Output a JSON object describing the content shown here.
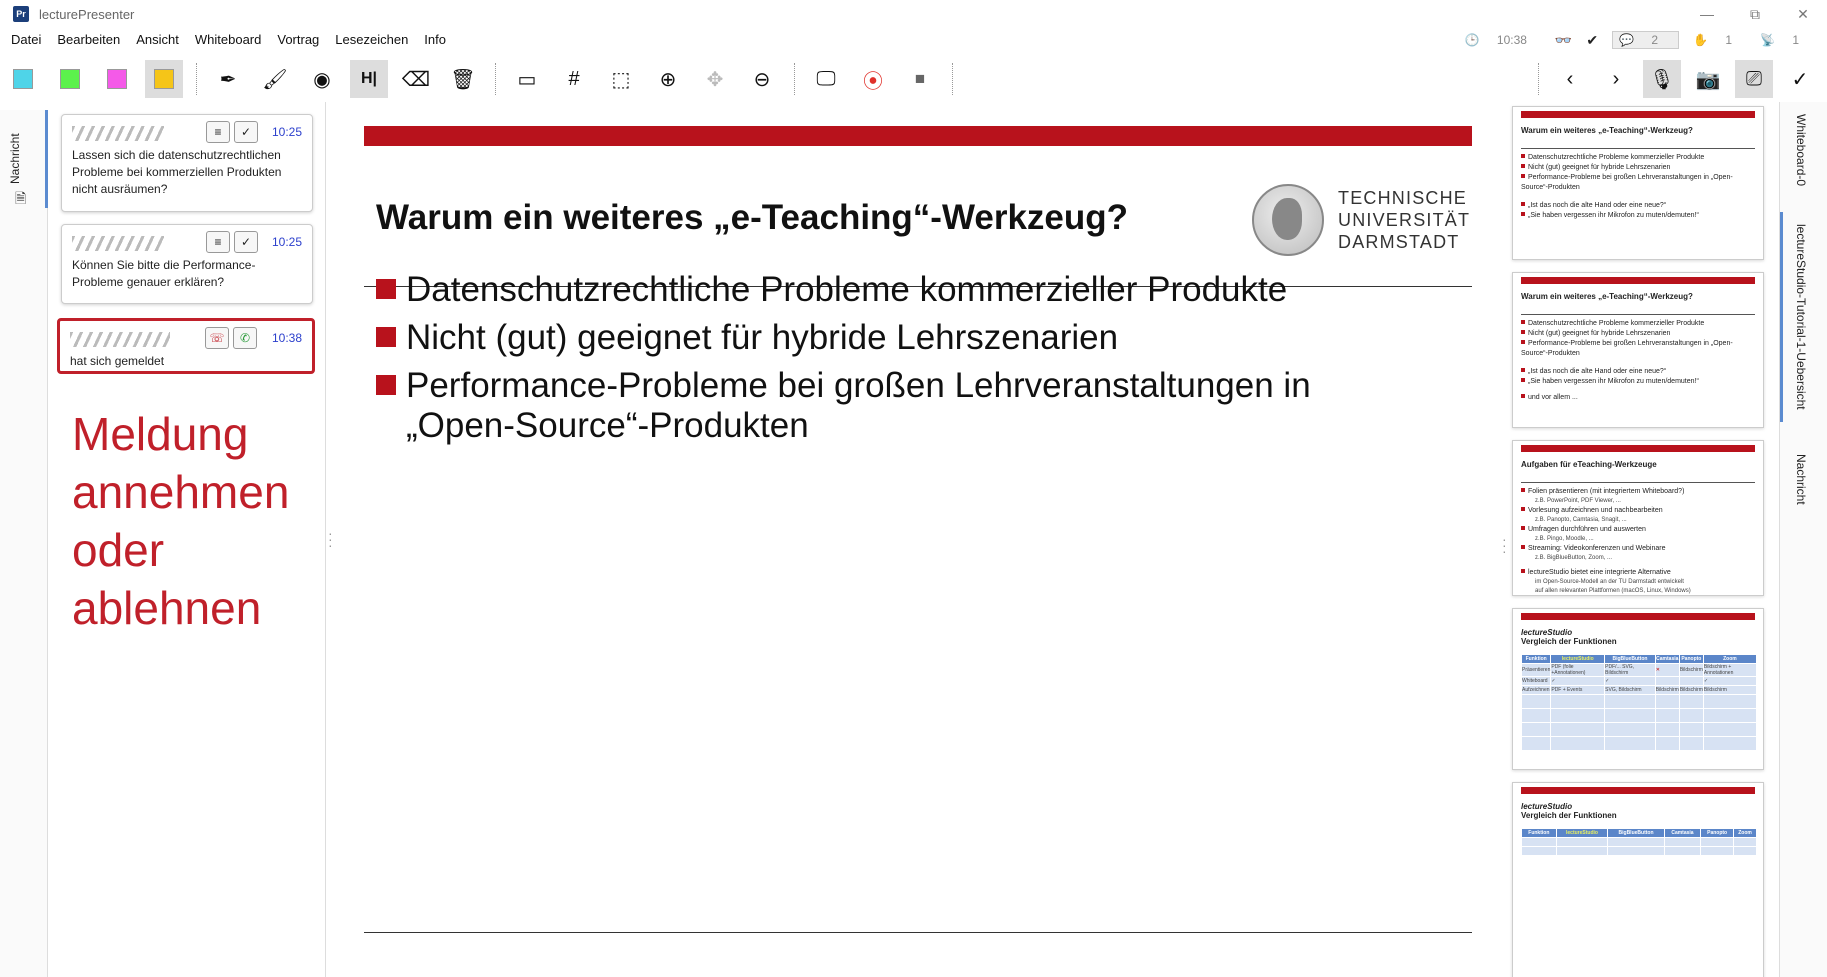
{
  "titlebar": {
    "app_icon": "Pr",
    "title": "lecturePresenter",
    "minimize": "—",
    "maximize": "⧉",
    "close": "✕"
  },
  "menu": [
    "Datei",
    "Bearbeiten",
    "Ansicht",
    "Whiteboard",
    "Vortrag",
    "Lesezeichen",
    "Info"
  ],
  "status": {
    "time": "10:38",
    "hands_count": "2",
    "speech_count": "1",
    "stream_count": "1",
    "hand_value": "1"
  },
  "toolbar": {
    "colors": [
      "#4fd4e8",
      "#5cf24c",
      "#f45ae8",
      "#f5c518"
    ],
    "tools": [
      "pen-icon",
      "highlighter-icon",
      "pointer-icon",
      "text-icon",
      "eraser-icon",
      "trash-icon",
      "grid-image-icon",
      "grid-icon",
      "select-icon",
      "zoom-in-icon",
      "pan-icon",
      "zoom-out-icon",
      "screen-icon",
      "record-icon",
      "stop-icon"
    ],
    "right": [
      "prev-icon",
      "next-icon",
      "microphone-icon",
      "camera-icon",
      "cast-icon",
      "check-icon"
    ]
  },
  "left_tab": "Nachricht",
  "messages": [
    {
      "time": "10:25",
      "text": "Lassen sich die datenschutzrechtlichen Probleme bei kommerziellen Produkten nicht ausräumen?"
    },
    {
      "time": "10:25",
      "text": "Können Sie bitte die Performance-Probleme genauer erklären?"
    },
    {
      "time": "10:38",
      "text": "hat sich gemeldet"
    }
  ],
  "annotation": [
    "Meldung",
    "annehmen",
    "oder",
    "ablehnen"
  ],
  "slide": {
    "title": "Warum ein weiteres „e-Teaching“-Werkzeug?",
    "logo": [
      "TECHNISCHE",
      "UNIVERSITÄT",
      "DARMSTADT"
    ],
    "bullets": [
      "Datenschutzrechtliche Probleme kommerzieller Produkte",
      "Nicht (gut) geeignet für hybride Lehrszenarien",
      "Performance-Probleme bei großen Lehrveranstaltungen in",
      "„Open-Source“-Produkten"
    ]
  },
  "thumbs": [
    {
      "title": "Warum ein weiteres „e-Teaching“-Werkzeug?",
      "lines": [
        "Datenschutzrechtliche Probleme kommerzieller Produkte",
        "Nicht (gut) geeignet für hybride Lehrszenarien",
        "Performance-Probleme bei großen Lehrveranstaltungen in „Open-Source“-Produkten",
        "„Ist das noch die alte Hand oder eine neue?“",
        "„Sie haben vergessen ihr Mikrofon zu muten/demuten!“"
      ]
    },
    {
      "title": "Warum ein weiteres „e-Teaching“-Werkzeug?",
      "lines": [
        "Datenschutzrechtliche Probleme kommerzieller Produkte",
        "Nicht (gut) geeignet für hybride Lehrszenarien",
        "Performance-Probleme bei großen Lehrveranstaltungen in „Open-Source“-Produkten",
        "„Ist das noch die alte Hand oder eine neue?“",
        "„Sie haben vergessen ihr Mikrofon zu muten/demuten!“",
        "und vor allem ..."
      ]
    },
    {
      "title": "Aufgaben für eTeaching-Werkzeuge",
      "items": [
        {
          "b": "Folien präsentieren (mit integriertem Whiteboard?)",
          "s": "z.B. PowerPoint, PDF Viewer, ..."
        },
        {
          "b": "Vorlesung aufzeichnen und nachbearbeiten",
          "s": "z.B. Panopto, Camtasia, Snagit, ..."
        },
        {
          "b": "Umfragen durchführen und auswerten",
          "s": "z.B. Pingo, Moodle, ..."
        },
        {
          "b": "Streaming: Videokonferenzen und Webinare",
          "s": "z.B. BigBlueButton, Zoom, ..."
        },
        {
          "b": "lectureStudio bietet eine integrierte Alternative",
          "s": "im Open-Source-Modell an der TU Darmstadt entwickelt"
        }
      ],
      "extra": "auf allen relevanten Plattformen (macOS, Linux, Windows)"
    },
    {
      "title1": "lectureStudio",
      "title2": "Vergleich der Funktionen",
      "header": [
        "Funktion",
        "lectureStudio",
        "BigBlueButton",
        "Camtasia",
        "Panopto",
        "Zoom"
      ],
      "rows": [
        [
          "Präsentieren",
          "PDF (folie +Annotationen)",
          "PDF/... SVG, Bildschirm",
          "✕",
          "Bildschirm",
          "Bildschirm + Annotationen"
        ],
        [
          "Whiteboard",
          "✓",
          "✓",
          "",
          "",
          "✓"
        ],
        [
          "Aufzeichnen",
          "PDF + Events",
          "SVG, Bildschirm",
          "Bildschirm",
          "Bildschirm",
          "Bildschirm"
        ]
      ]
    },
    {
      "title1": "lectureStudio",
      "title2": "Vergleich der Funktionen",
      "header": [
        "Funktion",
        "lectureStudio",
        "BigBlueButton",
        "Camtasia",
        "Panopto",
        "Zoom"
      ]
    }
  ],
  "right_tabs": [
    "Whiteboard-0",
    "lectureStudio-Tutorial-1-Uebersicht",
    "Nachricht"
  ]
}
